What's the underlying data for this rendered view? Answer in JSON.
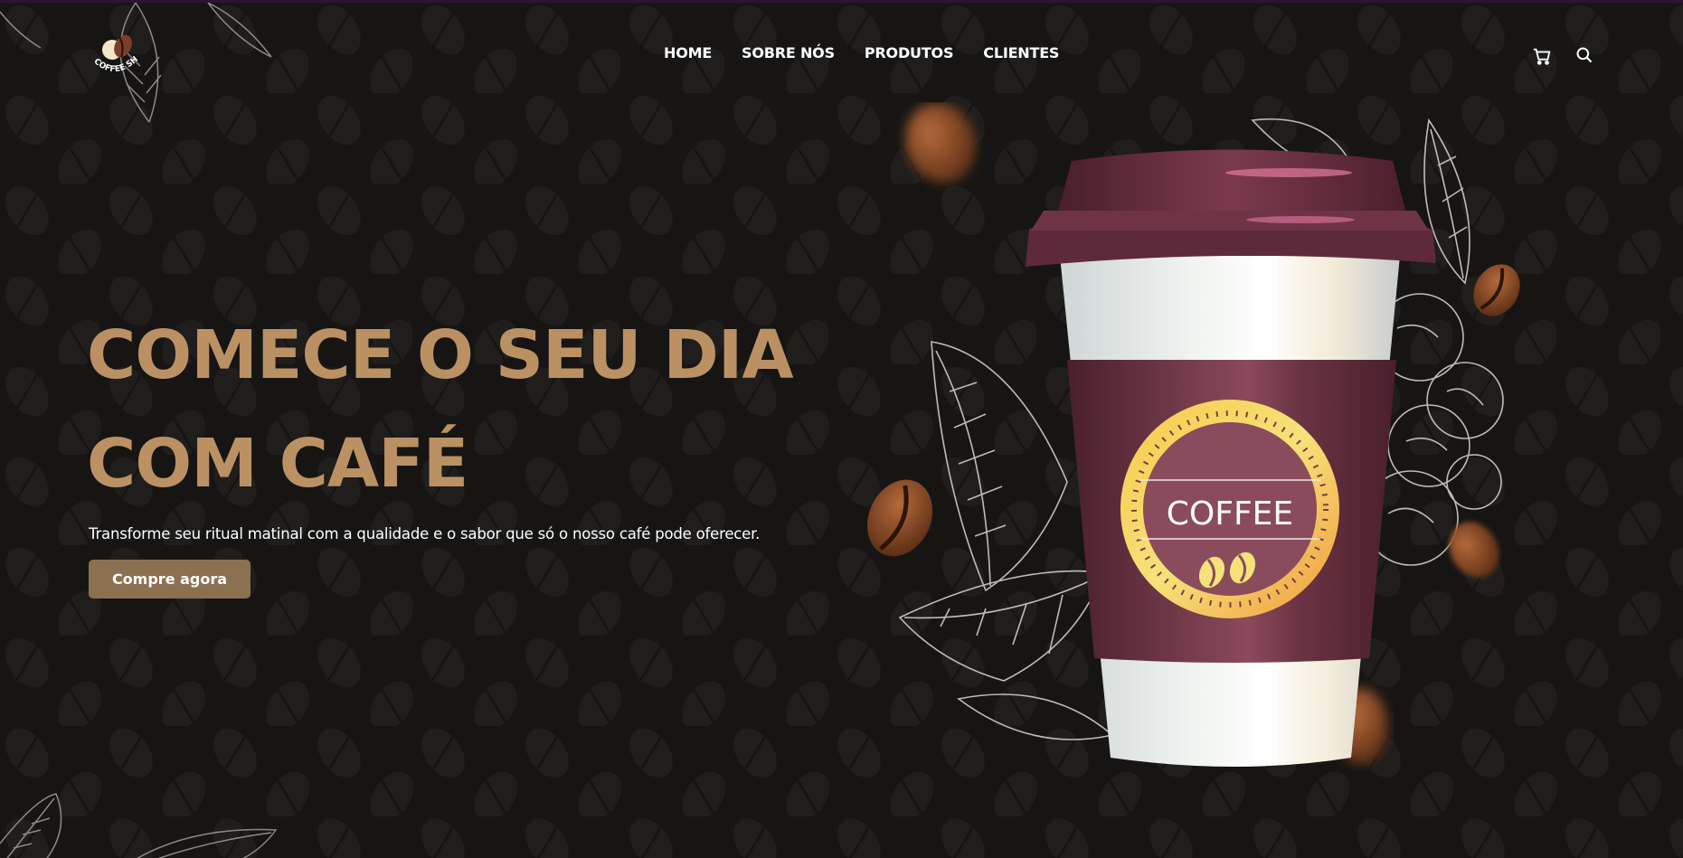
{
  "header": {
    "logo_text": "COFFEE SHOP",
    "nav": [
      "HOME",
      "SOBRE NÓS",
      "PRODUTOS",
      "CLIENTES"
    ],
    "icons": [
      "cart-icon",
      "search-icon"
    ]
  },
  "hero": {
    "title_line1": "COMECE O SEU DIA",
    "title_line2": "COM CAFÉ",
    "subtitle": "Transforme seu ritual matinal com a qualidade e o sabor que só o nosso café pode oferecer.",
    "cta_label": "Compre agora",
    "cup_label": "COFFEE"
  },
  "colors": {
    "background": "#161514",
    "accent": "#bb9164",
    "button": "#8c7151",
    "cup_sleeve": "#6b3444",
    "cup_lid": "#5e2a3b"
  }
}
